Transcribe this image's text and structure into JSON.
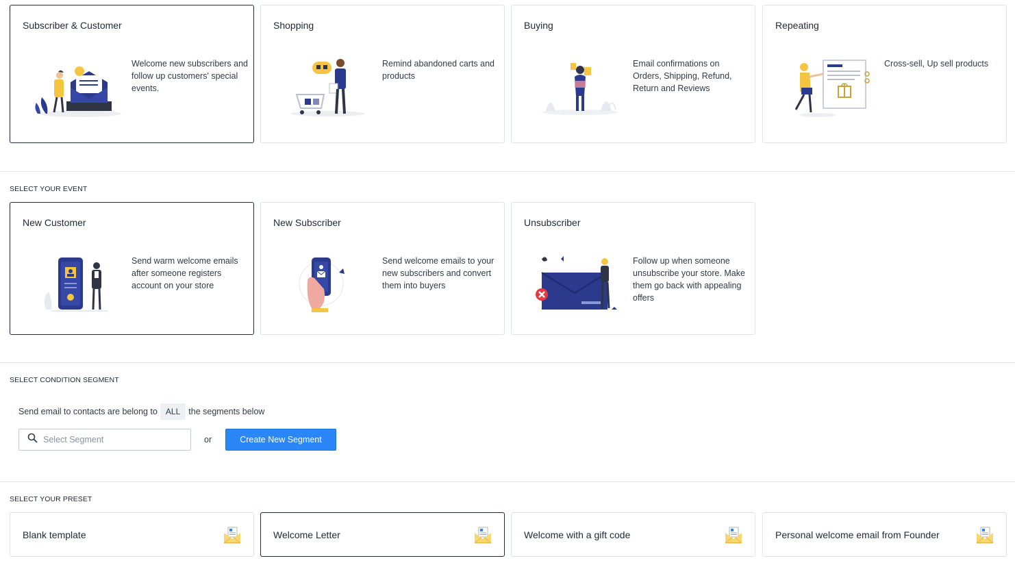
{
  "categories": [
    {
      "title": "Subscriber & Customer",
      "desc": "Welcome new subscribers and follow up customers' special events.",
      "illustration": "subscriber-customer-illustration"
    },
    {
      "title": "Shopping",
      "desc": "Remind abandoned carts and products",
      "illustration": "shopping-illustration"
    },
    {
      "title": "Buying",
      "desc": "Email confirmations on Orders, Shipping, Refund, Return and Reviews",
      "illustration": "buying-illustration"
    },
    {
      "title": "Repeating",
      "desc": "Cross-sell, Up sell products",
      "illustration": "repeating-illustration"
    }
  ],
  "event_section": {
    "label": "SELECT YOUR EVENT",
    "events": [
      {
        "title": "New Customer",
        "desc": "Send warm welcome emails after someone registers account on your store",
        "illustration": "new-customer-illustration"
      },
      {
        "title": "New Subscriber",
        "desc": "Send welcome emails to your new subscribers and convert them into buyers",
        "illustration": "new-subscriber-illustration"
      },
      {
        "title": "Unsubscriber",
        "desc": "Follow up when someone unsubscribe your store. Make them go back with appealing offers",
        "illustration": "unsubscriber-illustration"
      }
    ]
  },
  "condition_section": {
    "label": "SELECT CONDITION SEGMENT",
    "text_before": "Send email to contacts are belong to",
    "match_value": "ALL",
    "text_after": "the segments below",
    "search_placeholder": "Select Segment",
    "search_icon": "search-icon",
    "or_text": "or",
    "create_button": "Create New Segment"
  },
  "preset_section": {
    "label": "SELECT YOUR PRESET",
    "presets": [
      {
        "label": "Blank template",
        "icon": "envelope-letter-icon"
      },
      {
        "label": "Welcome Letter",
        "icon": "envelope-letter-icon"
      },
      {
        "label": "Welcome with a gift code",
        "icon": "envelope-letter-icon"
      },
      {
        "label": "Personal welcome email from Founder",
        "icon": "envelope-letter-icon"
      }
    ]
  },
  "colors": {
    "accent": "#2b86f7",
    "navy": "#2b3a8c",
    "yellow": "#f5c542",
    "selected_border": "#212b36",
    "border": "#dfe3e8"
  }
}
